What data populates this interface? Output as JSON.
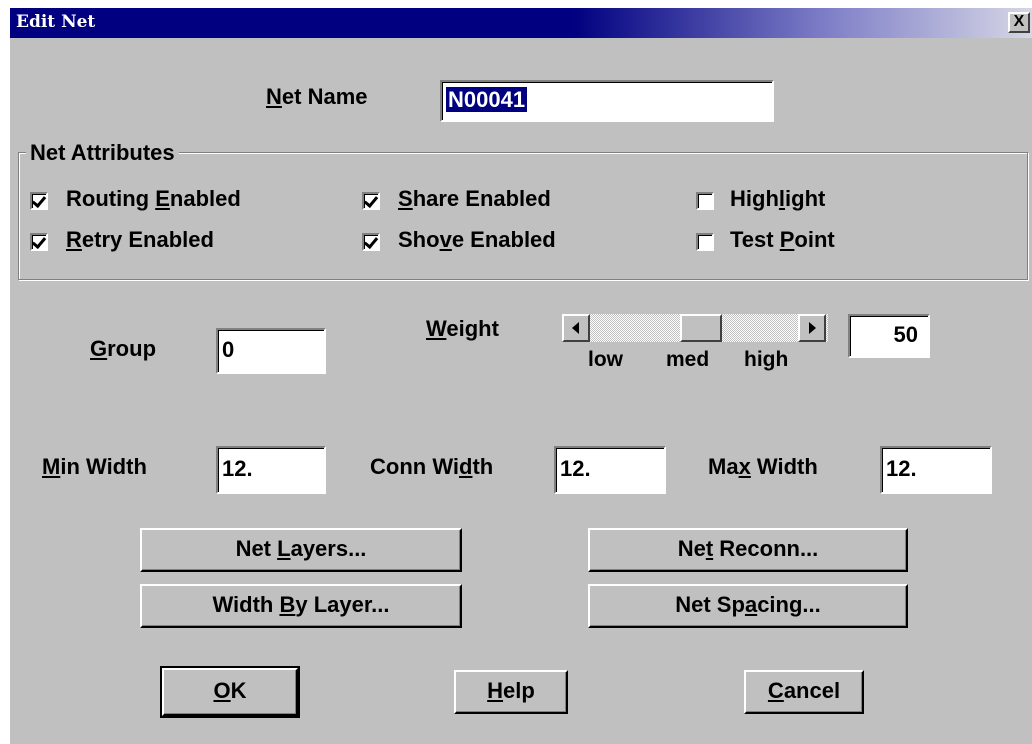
{
  "window": {
    "title": "Edit Net",
    "close_glyph": "X"
  },
  "net_name": {
    "label_pre": "",
    "label_u": "N",
    "label_post": "et Name",
    "value": "N00041"
  },
  "attributes": {
    "title": "Net Attributes",
    "items": [
      {
        "pre": "Routing ",
        "u": "E",
        "post": "nabled",
        "checked": true
      },
      {
        "pre": "",
        "u": "R",
        "post": "etry Enabled",
        "checked": true
      },
      {
        "pre": "",
        "u": "S",
        "post": "hare Enabled",
        "checked": true
      },
      {
        "pre": "Sho",
        "u": "v",
        "post": "e Enabled",
        "checked": true
      },
      {
        "pre": "High",
        "u": "l",
        "post": "ight",
        "checked": false
      },
      {
        "pre": "Test ",
        "u": "P",
        "post": "oint",
        "checked": false
      }
    ]
  },
  "group": {
    "pre": "",
    "u": "G",
    "post": "roup",
    "value": "0"
  },
  "weight": {
    "pre": "",
    "u": "W",
    "post": "eight",
    "value": "50",
    "scale_low": "low",
    "scale_med": "med",
    "scale_high": "high"
  },
  "widths": {
    "min": {
      "pre": "",
      "u": "M",
      "post": "in Width",
      "value": "12."
    },
    "conn": {
      "pre": "Conn Wi",
      "u": "d",
      "post": "th",
      "value": "12."
    },
    "max": {
      "pre": "Ma",
      "u": "x",
      "post": " Width",
      "value": "12."
    }
  },
  "buttons": {
    "net_layers": {
      "pre": "Net ",
      "u": "L",
      "post": "ayers..."
    },
    "width_by_layer": {
      "pre": "Width ",
      "u": "B",
      "post": "y Layer..."
    },
    "net_reconn": {
      "pre": "Ne",
      "u": "t",
      "post": " Reconn..."
    },
    "net_spacing": {
      "pre": "Net Sp",
      "u": "a",
      "post": "cing..."
    },
    "ok": {
      "pre": "",
      "u": "O",
      "post": "K"
    },
    "help": {
      "pre": "",
      "u": "H",
      "post": "elp"
    },
    "cancel": {
      "pre": "",
      "u": "C",
      "post": "ancel"
    }
  },
  "colors": {
    "titlebar": "#000080",
    "face": "#c0c0c0",
    "selection": "#000080"
  }
}
